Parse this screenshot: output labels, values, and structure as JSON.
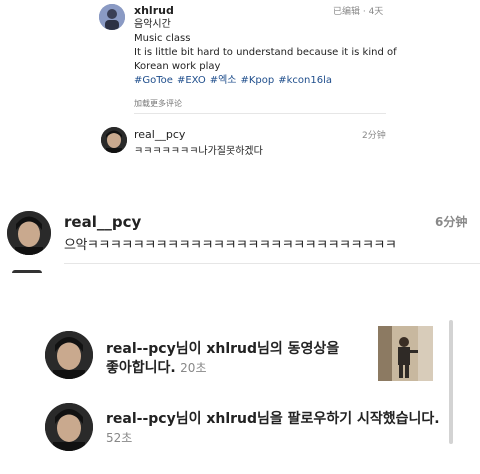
{
  "post": {
    "username": "xhlrud",
    "meta": "已编辑 · 4天",
    "caption_lines": [
      "음악시간",
      "Music class",
      "It is little bit hard to understand because it is kind of",
      "Korean work play"
    ],
    "hashtags": [
      "#GoToe",
      "#EXO",
      "#엑소",
      "#Kpop",
      "#kcon16la"
    ],
    "load_more": "加载更多评论"
  },
  "comment_small": {
    "username": "real__pcy",
    "time": "2分钟",
    "text": "ㅋㅋㅋㅋㅋㅋㅋ나가질못하겠다"
  },
  "comment_large": {
    "username": "real__pcy",
    "time": "6分钟",
    "text": "으악ㅋㅋㅋㅋㅋㅋㅋㅋㅋㅋㅋㅋㅋㅋㅋㅋㅋㅋㅋㅋㅋㅋㅋㅋㅋㅋㅋ"
  },
  "notifications": [
    {
      "username": "real--pcy",
      "text_line1": "님이 xhlrud님의 동영상을",
      "text_line2": "좋아합니다.",
      "time": "20초"
    },
    {
      "username": "real--pcy",
      "text_line1": "님이 xhlrud님을 팔로우하기 시작했습니다.",
      "time": "52초"
    }
  ],
  "colors": {
    "hashtag": "#1f4e8c",
    "meta_gray": "#888888",
    "divider": "#e6e6e6"
  }
}
